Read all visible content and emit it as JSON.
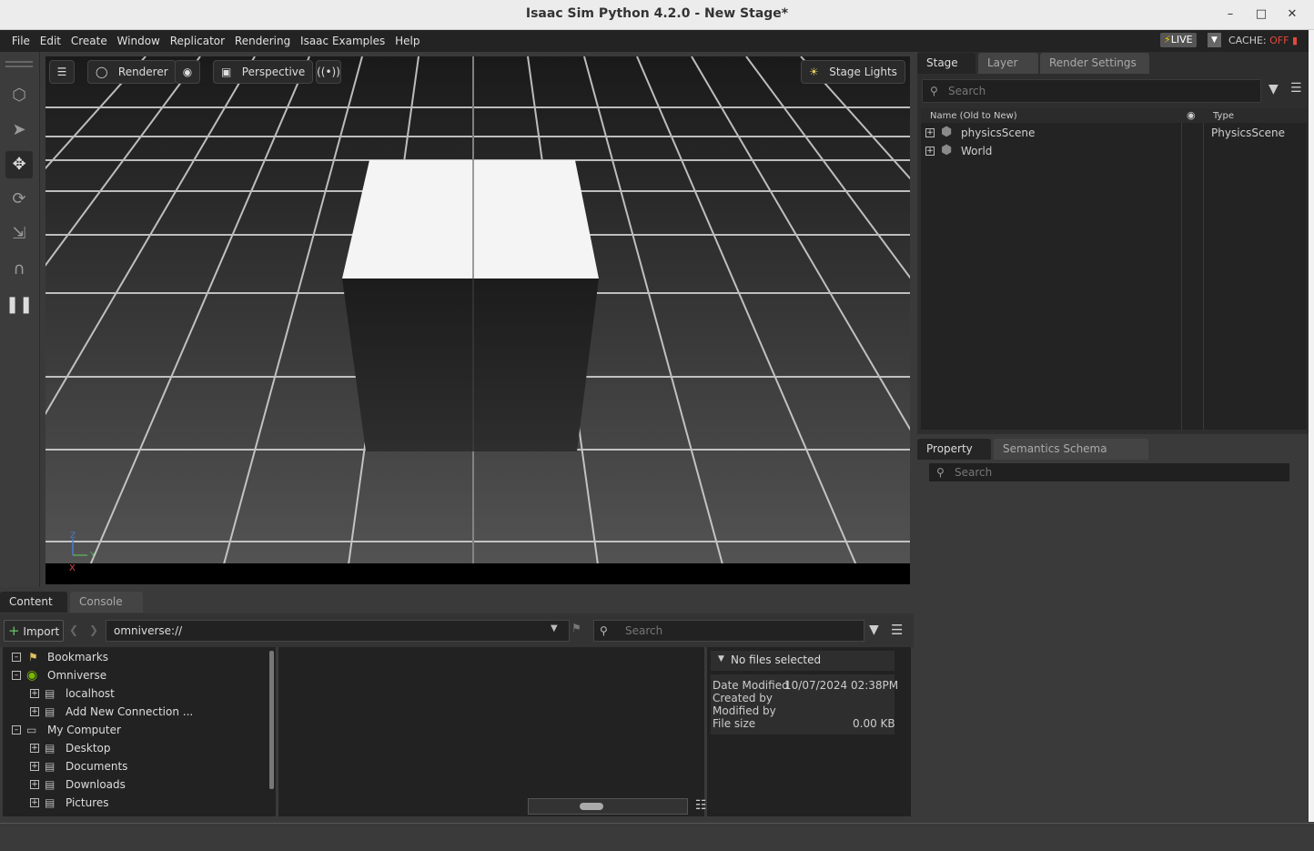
{
  "window": {
    "title": "Isaac Sim Python 4.2.0 - New Stage*"
  },
  "menu": [
    "File",
    "Edit",
    "Create",
    "Window",
    "Replicator",
    "Rendering",
    "Isaac Examples",
    "Help"
  ],
  "status": {
    "live_label": "LIVE",
    "cache_label": "CACHE:",
    "cache_state": "OFF"
  },
  "viewport": {
    "renderer_label": "Renderer",
    "camera_label": "Perspective",
    "lights_label": "Stage Lights",
    "axis_y": "Y",
    "axis_z": "Z",
    "axis_x": "X"
  },
  "stage_panel": {
    "tabs": [
      "Stage",
      "Layer",
      "Render Settings"
    ],
    "search_placeholder": "Search",
    "columns": {
      "name": "Name (Old to New)",
      "type": "Type"
    },
    "items": [
      {
        "name": "physicsScene",
        "type": "PhysicsScene"
      },
      {
        "name": "World",
        "type": ""
      }
    ]
  },
  "property_panel": {
    "tabs": [
      "Property",
      "Semantics Schema Editor"
    ],
    "search_placeholder": "Search"
  },
  "content_panel": {
    "tabs": [
      "Content",
      "Console"
    ],
    "import_label": "Import",
    "path": "omniverse://",
    "search_placeholder": "Search",
    "tree": [
      {
        "label": "Bookmarks",
        "level": 0
      },
      {
        "label": "Omniverse",
        "level": 0
      },
      {
        "label": "localhost",
        "level": 1
      },
      {
        "label": "Add New Connection ...",
        "level": 1
      },
      {
        "label": "My Computer",
        "level": 0
      },
      {
        "label": "Desktop",
        "level": 1
      },
      {
        "label": "Documents",
        "level": 1
      },
      {
        "label": "Downloads",
        "level": 1
      },
      {
        "label": "Pictures",
        "level": 1
      }
    ],
    "info": {
      "header": "No files selected",
      "date_modified_label": "Date Modified",
      "date_modified_value": "10/07/2024 02:38PM",
      "created_by_label": "Created by",
      "modified_by_label": "Modified by",
      "file_size_label": "File size",
      "file_size_value": "0.00 KB"
    }
  }
}
